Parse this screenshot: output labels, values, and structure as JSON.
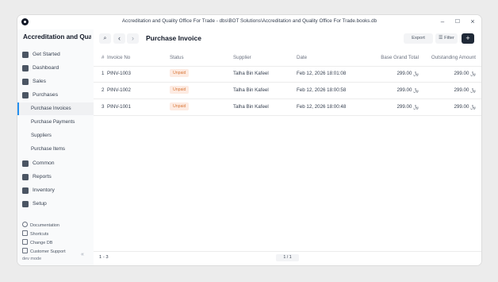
{
  "window": {
    "title": "Accreditation and Quality Office For Trade - dbs\\BOT Solutions\\Accreditation and Quality Office For Trade.books.db",
    "controls": [
      "–",
      "☐",
      "×"
    ]
  },
  "sidebar": {
    "company": "Accreditation and Quality Office For Trade",
    "items": [
      {
        "label": "Get Started",
        "icon": "rocket-icon"
      },
      {
        "label": "Dashboard",
        "icon": "dashboard-icon"
      },
      {
        "label": "Sales",
        "icon": "sales-icon"
      },
      {
        "label": "Purchases",
        "icon": "purchases-icon"
      },
      {
        "label": "Common",
        "icon": "common-icon"
      },
      {
        "label": "Reports",
        "icon": "reports-icon"
      },
      {
        "label": "Inventory",
        "icon": "inventory-icon"
      },
      {
        "label": "Setup",
        "icon": "setup-icon"
      }
    ],
    "purchases_sub": [
      "Purchase Invoices",
      "Purchase Payments",
      "Suppliers",
      "Purchase Items"
    ],
    "footer": [
      {
        "label": "Documentation",
        "icon": "help-icon"
      },
      {
        "label": "Shortcuts",
        "icon": "keyboard-icon"
      },
      {
        "label": "Change DB",
        "icon": "database-icon"
      },
      {
        "label": "Customer Support",
        "icon": "flag-icon"
      }
    ],
    "dev_mode": "dev mode",
    "collapse_glyph": "«"
  },
  "toolbar": {
    "search_glyph": "⌕",
    "back_glyph": "‹",
    "forward_glyph": "›",
    "page_title": "Purchase Invoice",
    "export_label": "Export",
    "filter_label": "Filter",
    "add_label": "+"
  },
  "table": {
    "headers": {
      "index": "#",
      "invoice": "Invoice No",
      "status": "Status",
      "supplier": "Supplier",
      "date": "Date",
      "total": "Base Grand Total",
      "outstanding": "Outstanding Amount"
    },
    "rows": [
      {
        "index": "1",
        "invoice": "PINV-1003",
        "status": "Unpaid",
        "supplier": "Talha Bin Kafeel",
        "date": "Feb 12, 2026 18:01:08",
        "total": "299.00 ﷼",
        "outstanding": "299.00 ﷼"
      },
      {
        "index": "2",
        "invoice": "PINV-1002",
        "status": "Unpaid",
        "supplier": "Talha Bin Kafeel",
        "date": "Feb 12, 2026 18:00:58",
        "total": "299.00 ﷼",
        "outstanding": "299.00 ﷼"
      },
      {
        "index": "3",
        "invoice": "PINV-1001",
        "status": "Unpaid",
        "supplier": "Talha Bin Kafeel",
        "date": "Feb 12, 2026 18:00:48",
        "total": "299.00 ﷼",
        "outstanding": "299.00 ﷼"
      }
    ]
  },
  "statusbar": {
    "count": "1 - 3",
    "page": "1 / 1"
  },
  "colors": {
    "accent": "#2490ef",
    "badge_bg": "#fdebe2",
    "badge_text": "#d9793b",
    "primary_button": "#1f2937"
  }
}
